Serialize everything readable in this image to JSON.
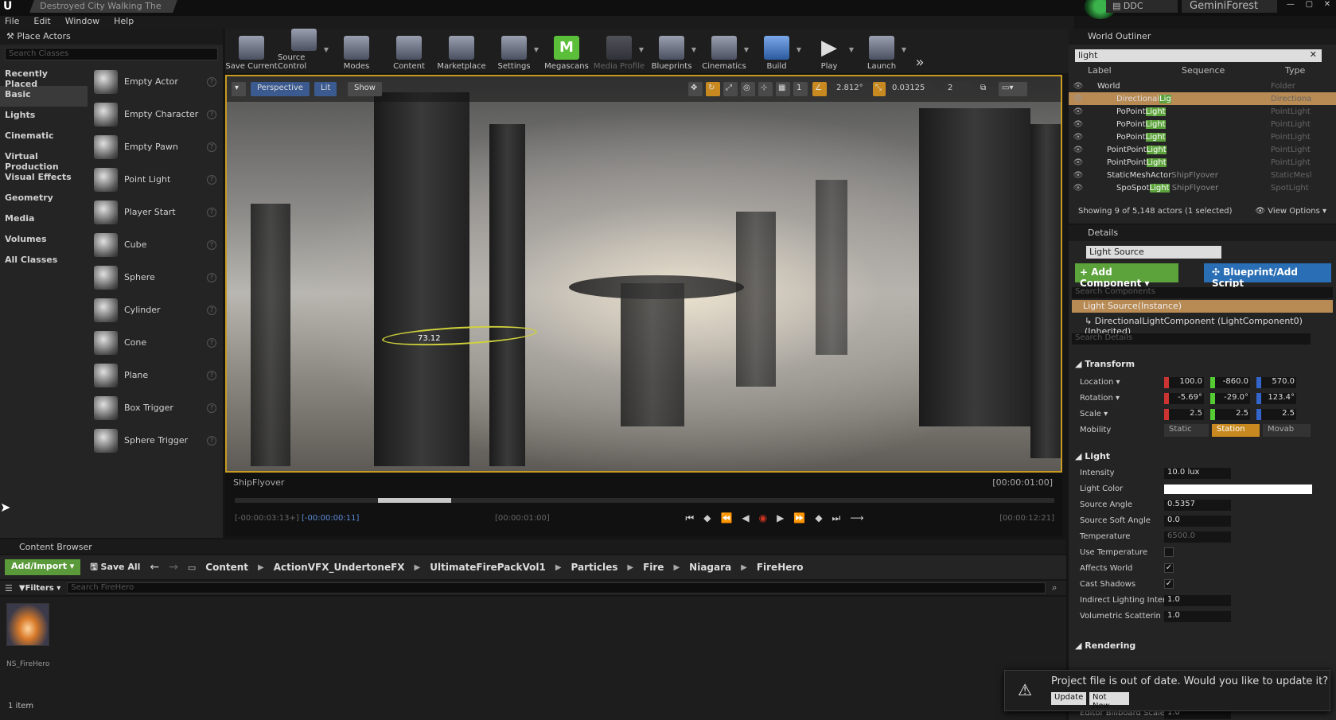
{
  "window": {
    "tab_title": "Destroyed City Walking The",
    "ddc_label": "DDC",
    "project_name": "GeminiForest",
    "menu": [
      "File",
      "Edit",
      "Window",
      "Help"
    ]
  },
  "place_actors": {
    "title": "Place Actors",
    "search_placeholder": "Search Classes",
    "categories": [
      "Recently Placed",
      "Basic",
      "Lights",
      "Cinematic",
      "Virtual Production",
      "Visual Effects",
      "Geometry",
      "Media",
      "Volumes",
      "All Classes"
    ],
    "active_category": "Basic",
    "items": [
      "Empty Actor",
      "Empty Character",
      "Empty Pawn",
      "Point Light",
      "Player Start",
      "Cube",
      "Sphere",
      "Cylinder",
      "Cone",
      "Plane",
      "Box Trigger",
      "Sphere Trigger"
    ]
  },
  "toolbar": {
    "buttons": [
      {
        "label": "Save Current",
        "icon": "save-icon"
      },
      {
        "label": "Source Control",
        "icon": "source-control-icon"
      },
      {
        "label": "Modes",
        "icon": "modes-icon"
      },
      {
        "label": "Content",
        "icon": "content-icon"
      },
      {
        "label": "Marketplace",
        "icon": "marketplace-icon"
      },
      {
        "label": "Settings",
        "icon": "settings-icon"
      },
      {
        "label": "Megascans",
        "icon": "megascans-icon"
      },
      {
        "label": "Media Profile",
        "icon": "media-profile-icon"
      },
      {
        "label": "Blueprints",
        "icon": "blueprints-icon"
      },
      {
        "label": "Cinematics",
        "icon": "cinematics-icon"
      },
      {
        "label": "Build",
        "icon": "build-icon"
      },
      {
        "label": "Play",
        "icon": "play-icon"
      },
      {
        "label": "Launch",
        "icon": "launch-icon"
      }
    ],
    "megascans_glyph": "M"
  },
  "viewport": {
    "perspective_label": "Perspective",
    "lit_label": "Lit",
    "show_label": "Show",
    "snap_angle": "2.812°",
    "snap_scale": "0.03125",
    "camera_speed": "2",
    "grid_value": "1",
    "light_label": "73.12"
  },
  "sequencer": {
    "title": "ShipFlyover",
    "time_right": "[00:00:01:00]",
    "time_start": "[-00:00:03:13+]",
    "time_start2": "[-00:00:00:11]",
    "time_mid": "[00:00:01:00]",
    "time_end": "[00:00:12:21]",
    "progress": 0.27
  },
  "content_browser": {
    "title": "Content Browser",
    "add_import": "Add/Import",
    "save_all": "Save All",
    "breadcrumb": [
      "Content",
      "ActionVFX_UndertoneFX",
      "UltimateFirePackVol1",
      "Particles",
      "Fire",
      "Niagara",
      "FireHero"
    ],
    "filters": "Filters",
    "search_placeholder": "Search FireHero",
    "asset_name": "NS_FireHero",
    "item_count": "1 item"
  },
  "outliner": {
    "title": "World Outliner",
    "search_value": "light",
    "columns": [
      "Label",
      "Sequence",
      "Type"
    ],
    "rows": [
      {
        "pre": "World",
        "hl": "",
        "post": "",
        "type": "Folder",
        "indent": 0,
        "selected": false
      },
      {
        "pre": "Directional",
        "hl": "Lig",
        "post": "",
        "type": "Directiona",
        "indent": 2,
        "selected": true
      },
      {
        "pre": "PoPoint",
        "hl": "Light",
        "post": "",
        "type": "PointLight",
        "indent": 2,
        "selected": false
      },
      {
        "pre": "PoPoint",
        "hl": "Light",
        "post": "",
        "type": "PointLight",
        "indent": 2,
        "selected": false
      },
      {
        "pre": "PoPoint",
        "hl": "Light",
        "post": "",
        "type": "PointLight",
        "indent": 2,
        "selected": false
      },
      {
        "pre": "PointPoint",
        "hl": "Light",
        "post": "",
        "type": "PointLight",
        "indent": 1,
        "selected": false
      },
      {
        "pre": "PointPoint",
        "hl": "Light",
        "post": "",
        "type": "PointLight",
        "indent": 1,
        "selected": false
      },
      {
        "pre": "StaticMeshActor",
        "hl": "",
        "post": "ShipFlyover",
        "type": "StaticMesl",
        "indent": 1,
        "selected": false
      },
      {
        "pre": "SpoSpot",
        "hl": "Light",
        "post": " ShipFlyover",
        "type": "SpotLight",
        "indent": 2,
        "selected": false
      }
    ],
    "footer": "Showing 9 of 5,148 actors (1 selected)",
    "view_options": "View Options"
  },
  "details": {
    "title": "Details",
    "actor_name": "Light Source",
    "add_component": "+ Add Component",
    "blueprint_script": "Blueprint/Add Script",
    "search_components": "Search Components",
    "instance_label": "Light Source(Instance)",
    "component_label": "DirectionalLightComponent (LightComponent0) (Inherited)",
    "search_details": "Search Details",
    "transform": {
      "title": "Transform",
      "location": {
        "label": "Location",
        "x": "100.0",
        "y": "-860.0",
        "z": "570.0"
      },
      "rotation": {
        "label": "Rotation",
        "x": "-5.69°",
        "y": "-29.0°",
        "z": "123.4°"
      },
      "scale": {
        "label": "Scale",
        "x": "2.5",
        "y": "2.5",
        "z": "2.5"
      },
      "mobility_label": "Mobility",
      "mobility_options": [
        "Static",
        "Station",
        "Movab"
      ]
    },
    "light": {
      "title": "Light",
      "intensity": {
        "label": "Intensity",
        "value": "10.0 lux"
      },
      "light_color_label": "Light Color",
      "source_angle": {
        "label": "Source Angle",
        "value": "0.5357"
      },
      "source_soft_angle": {
        "label": "Source Soft Angle",
        "value": "0.0"
      },
      "temperature": {
        "label": "Temperature",
        "value": "6500.0"
      },
      "use_temperature": "Use Temperature",
      "affects_world": "Affects World",
      "cast_shadows": "Cast Shadows",
      "indirect": {
        "label": "Indirect Lighting Inten",
        "value": "1.0"
      },
      "volumetric": {
        "label": "Volumetric Scatterin",
        "value": "1.0"
      }
    },
    "rendering_title": "Rendering",
    "billboard": {
      "label": "Editor Billboard Scale",
      "value": "1.0"
    }
  },
  "toast": {
    "message": "Project file is out of date. Would you like to update it?",
    "update": "Update",
    "not_now": "Not Now"
  },
  "colors": {
    "accent_green": "#5ca33c",
    "selection": "#b88a54",
    "blueprint_blue": "#2a6fb5",
    "viewport_border": "#c89b20"
  }
}
